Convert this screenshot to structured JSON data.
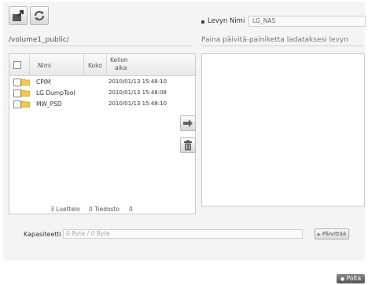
{
  "toolbar": {
    "upload_icon": "upload-icon",
    "refresh_icon": "refresh-icon"
  },
  "left": {
    "path": "/volume1_public/",
    "headers": {
      "name": "Nimi",
      "size": "Koko",
      "time_line1": "Kellon",
      "time_line2": "aika"
    },
    "rows": [
      {
        "name": "CPIM",
        "time": "2010/01/13 15:48:10"
      },
      {
        "name": "LG DumpTool",
        "time": "2010/01/13 15:48:08"
      },
      {
        "name": "MW_PSD",
        "time": "2010/01/13 15:48:10"
      }
    ],
    "footer": {
      "folders": "3 Luettelo",
      "files": "0 Tiedosto",
      "total": "0"
    }
  },
  "right": {
    "disc_label": "Levyn Nimi",
    "disc_value": "LG_NAS",
    "hint": "Paina päivitä-painiketta ladataksesi levyn"
  },
  "capacity": {
    "label": "Kapasiteetti",
    "value": "0 Byte / 0 Byte",
    "update_button": "Päivittää"
  },
  "burn_button": "Polta",
  "colors": {
    "folder": "#f2c94c",
    "panel": "#f4f4f4",
    "burn": "#666666"
  }
}
